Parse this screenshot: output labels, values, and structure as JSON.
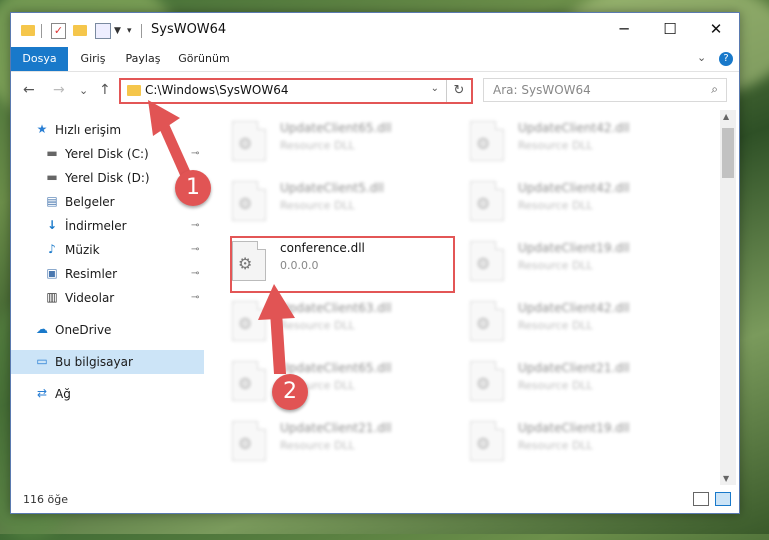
{
  "window": {
    "title": "SysWOW64",
    "controls": {
      "minimize": "─",
      "maximize": "☐",
      "close": "✕"
    }
  },
  "ribbon": {
    "tabs": [
      "Dosya",
      "Giriş",
      "Paylaş",
      "Görünüm"
    ],
    "active_tab": "Dosya",
    "expand": "⌄",
    "help": "?"
  },
  "navigation": {
    "back": "←",
    "forward": "→",
    "recent": "⌄",
    "up": "↑"
  },
  "address": {
    "path": "C:\\Windows\\SysWOW64",
    "dropdown": "⌄",
    "refresh": "↻"
  },
  "search": {
    "placeholder": "Ara: SysWOW64",
    "icon": "⌕"
  },
  "sidebar": {
    "items": [
      {
        "label": "Hızlı erişim",
        "icon": "★",
        "pinned": false
      },
      {
        "label": "Yerel Disk (C:)",
        "icon": "▬",
        "pinned": true
      },
      {
        "label": "Yerel Disk (D:)",
        "icon": "▬",
        "pinned": false
      },
      {
        "label": "Belgeler",
        "icon": "▤",
        "pinned": true
      },
      {
        "label": "İndirmeler",
        "icon": "↓",
        "pinned": true
      },
      {
        "label": "Müzik",
        "icon": "♪",
        "pinned": true
      },
      {
        "label": "Resimler",
        "icon": "▣",
        "pinned": true
      },
      {
        "label": "Videolar",
        "icon": "▥",
        "pinned": true
      },
      {
        "label": "OneDrive",
        "icon": "☁",
        "pinned": false
      },
      {
        "label": "Bu bilgisayar",
        "icon": "▭",
        "pinned": false,
        "selected": true
      },
      {
        "label": "Ağ",
        "icon": "⇄",
        "pinned": false
      }
    ],
    "pin_icon": "⊸"
  },
  "files": [
    {
      "name": "UpdateClient65.dll",
      "desc": "Resource DLL"
    },
    {
      "name": "UpdateClient42.dll",
      "desc": "Resource DLL"
    },
    {
      "name": "UpdateClient5.dll",
      "desc": "Resource DLL"
    },
    {
      "name": "UpdateClient42.dll",
      "desc": "Resource DLL"
    },
    {
      "name": "conference.dll",
      "desc": "0.0.0.0",
      "highlighted": true
    },
    {
      "name": "UpdateClient19.dll",
      "desc": "Resource DLL"
    },
    {
      "name": "UpdateClient63.dll",
      "desc": "Resource DLL"
    },
    {
      "name": "UpdateClient42.dll",
      "desc": "Resource DLL"
    },
    {
      "name": "UpdateClient65.dll",
      "desc": "Resource DLL"
    },
    {
      "name": "UpdateClient21.dll",
      "desc": "Resource DLL"
    },
    {
      "name": "UpdateClient21.dll",
      "desc": "Resource DLL"
    },
    {
      "name": "UpdateClient19.dll",
      "desc": "Resource DLL"
    }
  ],
  "status": {
    "count": "116 öğe"
  },
  "annotations": {
    "step1": "1",
    "step2": "2",
    "color": "#e15454"
  },
  "colors": {
    "accent": "#1979ca",
    "highlight": "#e35656",
    "selection": "#cce4f7"
  }
}
